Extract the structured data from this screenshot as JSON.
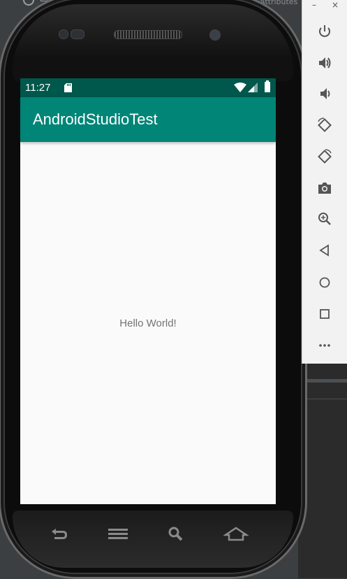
{
  "ide": {
    "tab_fragment": "Attributes"
  },
  "device": {
    "status_time": "11:27",
    "app_title": "AndroidStudioTest",
    "content_text": "Hello World!",
    "colors": {
      "status_bar": "#00574b",
      "app_bar": "#008577",
      "screen_bg": "#fafafa",
      "text": "#737373"
    }
  },
  "toolbar": {
    "minimize_label": "–",
    "close_label": "×",
    "buttons": [
      {
        "name": "power-icon"
      },
      {
        "name": "volume-up-icon"
      },
      {
        "name": "volume-down-icon"
      },
      {
        "name": "rotate-left-icon"
      },
      {
        "name": "rotate-right-icon"
      },
      {
        "name": "camera-icon"
      },
      {
        "name": "zoom-icon"
      },
      {
        "name": "back-icon"
      },
      {
        "name": "home-icon"
      },
      {
        "name": "overview-icon"
      },
      {
        "name": "more-icon"
      }
    ]
  },
  "hardware_keys": [
    "back-key-icon",
    "menu-key-icon",
    "search-key-icon",
    "home-key-icon"
  ]
}
